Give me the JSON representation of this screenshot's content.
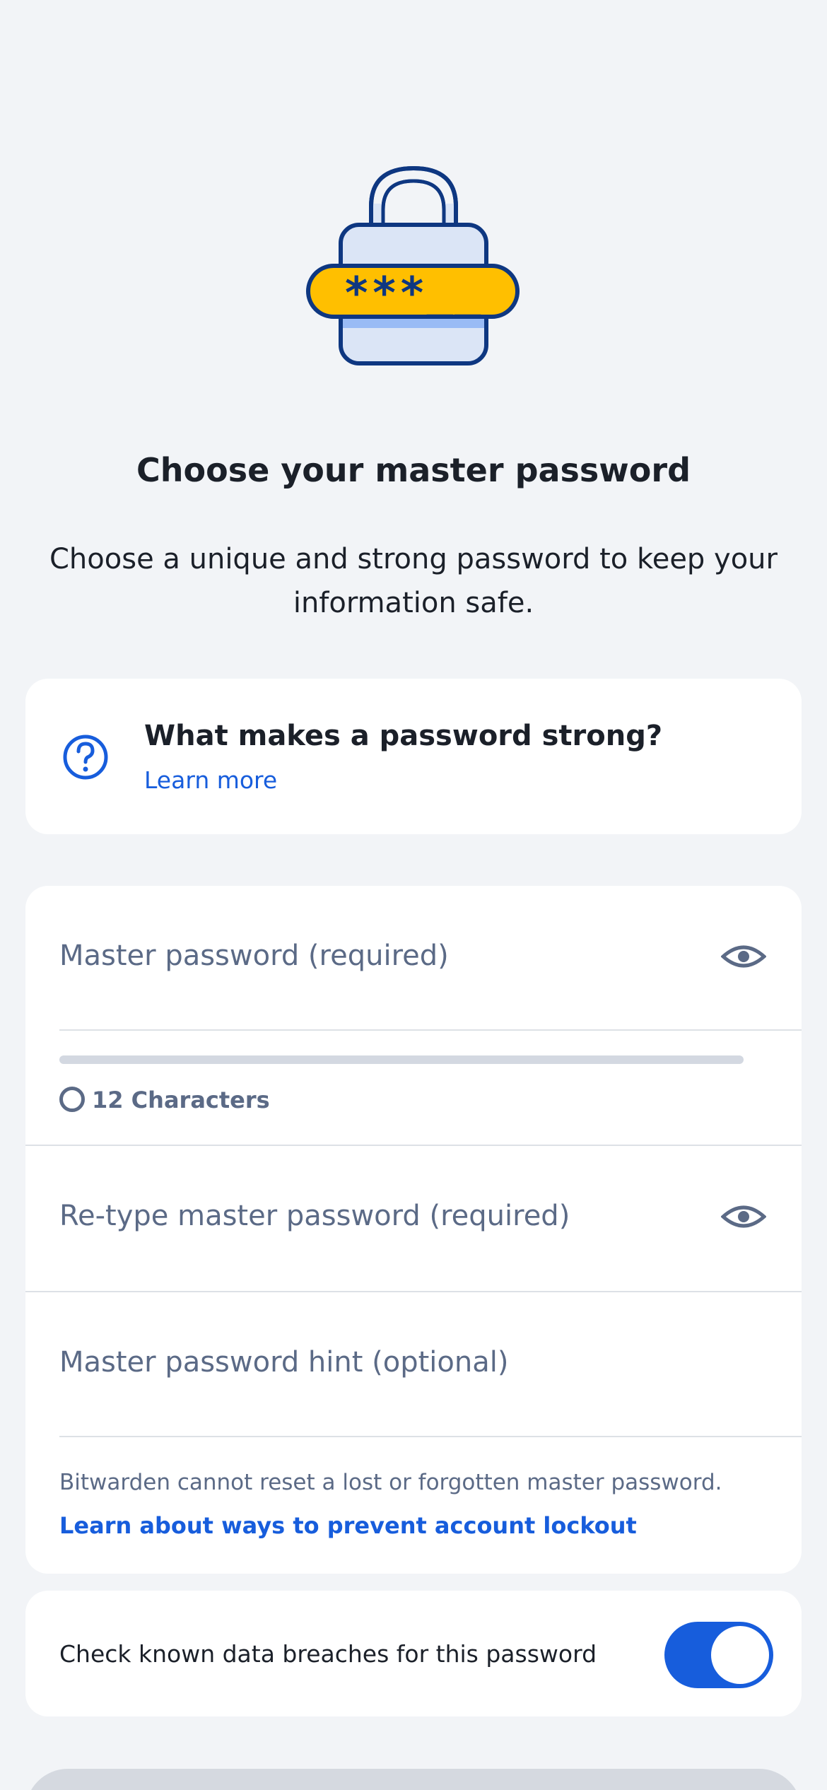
{
  "header": {
    "title": "Choose your master password",
    "subtitle": "Choose a unique and strong password to keep your information safe.",
    "illustration_text": "***__"
  },
  "tips": {
    "icon": "question-circle-icon",
    "title": "What makes a password strong?",
    "link": "Learn more"
  },
  "form": {
    "master_password_label": "Master password (required)",
    "strength_fraction": 0,
    "requirement_label": "12 Characters",
    "retype_label": "Re-type master password (required)",
    "hint_label": "Master password hint (optional)",
    "warning_text": "Bitwarden cannot reset a lost or forgotten master password.",
    "warning_link": "Learn about ways to prevent account lockout"
  },
  "breach_check": {
    "label": "Check known data breaches for this password",
    "enabled": true
  },
  "colors": {
    "accent": "#175ddc",
    "background": "#f2f4f7",
    "muted_text": "#5b6a86",
    "illustration_yellow": "#ffbf00",
    "illustration_navy": "#0e3781"
  }
}
